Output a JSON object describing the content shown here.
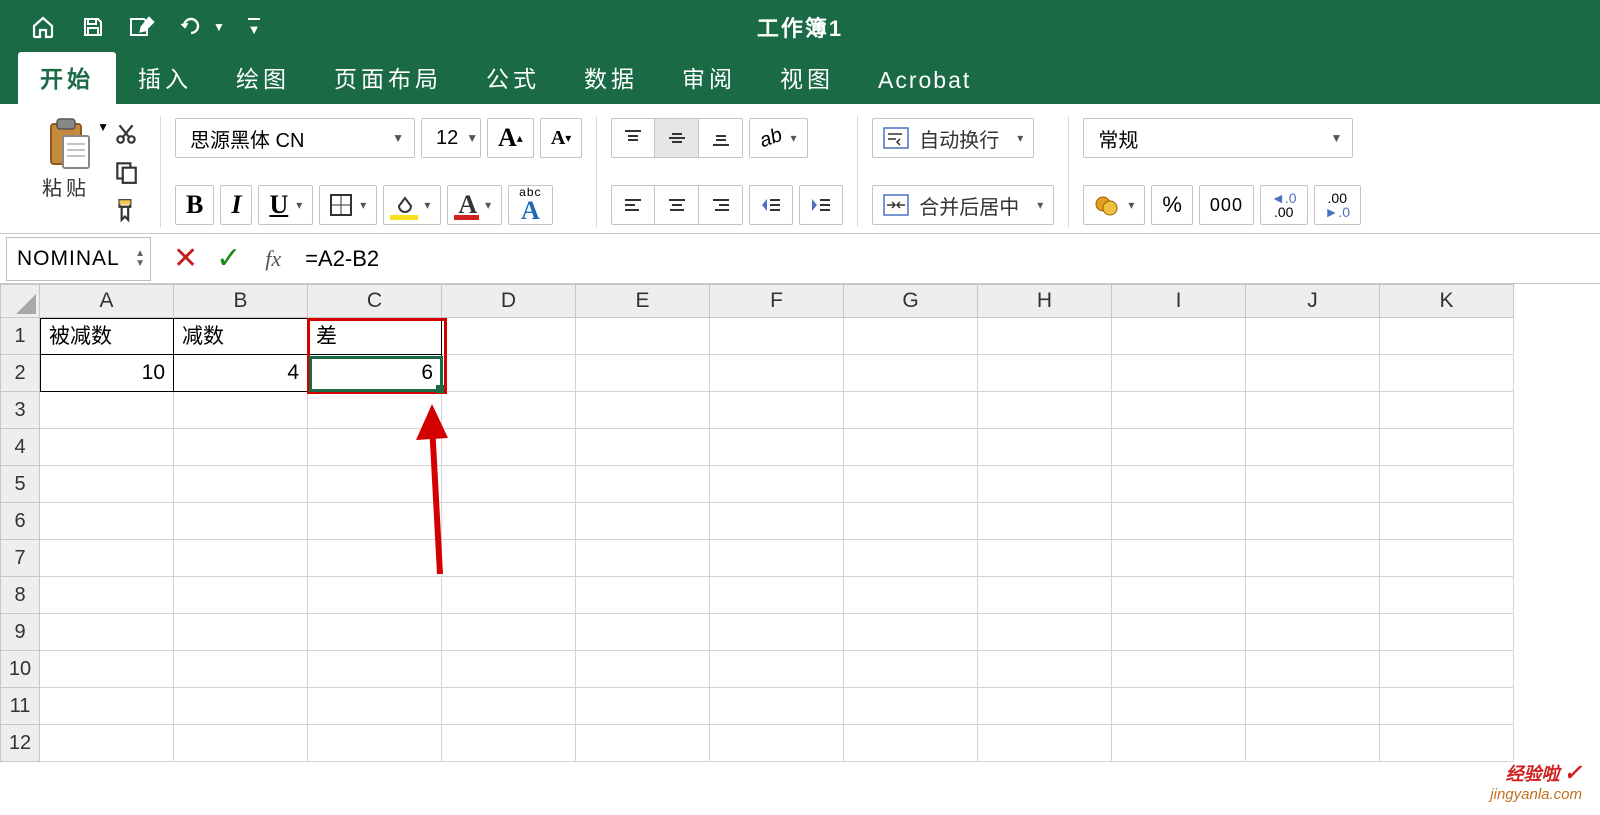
{
  "title": "工作簿1",
  "tabs": [
    "开始",
    "插入",
    "绘图",
    "页面布局",
    "公式",
    "数据",
    "审阅",
    "视图",
    "Acrobat"
  ],
  "ribbon": {
    "paste": "粘贴",
    "font_name": "思源黑体 CN",
    "font_size": "12",
    "wrap": "自动换行",
    "merge": "合并后居中",
    "numfmt": "常规",
    "thousands": "000",
    "pct": "%",
    "inc_dec0": ".0",
    "inc_dec00": ".00"
  },
  "formula_bar": {
    "name": "NOMINAL",
    "fx": "fx",
    "formula": "=A2-B2"
  },
  "columns": [
    "A",
    "B",
    "C",
    "D",
    "E",
    "F",
    "G",
    "H",
    "I",
    "J",
    "K"
  ],
  "rows": [
    "1",
    "2",
    "3",
    "4",
    "5",
    "6",
    "7",
    "8",
    "9",
    "10",
    "11",
    "12"
  ],
  "cells": {
    "A1": "被减数",
    "B1": "减数",
    "C1": "差",
    "A2": "10",
    "B2": "4",
    "C2": "6"
  },
  "brand": {
    "line1": "经验啦",
    "line2": "jingyanla.com"
  }
}
